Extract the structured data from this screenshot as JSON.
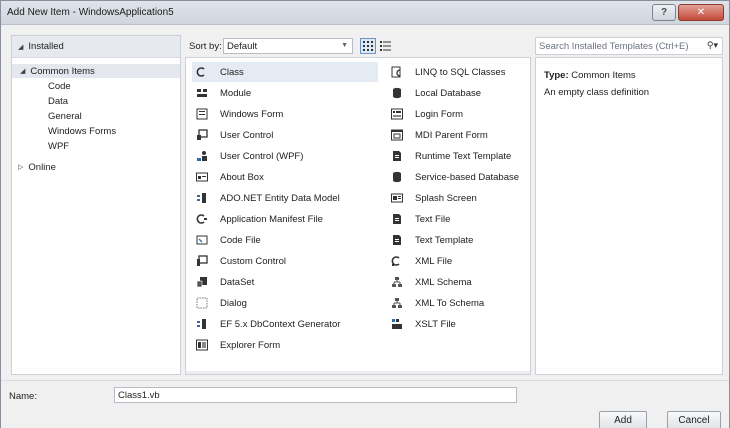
{
  "window": {
    "title": "Add New Item - WindowsApplication5",
    "help_label": "?",
    "close_label": "✕"
  },
  "tree": {
    "installed": "Installed",
    "common_items": "Common Items",
    "children": [
      "Code",
      "Data",
      "General",
      "Windows Forms",
      "WPF"
    ],
    "online": "Online"
  },
  "toolbar": {
    "sort_by_label": "Sort by:",
    "sort_value": "Default"
  },
  "templates": {
    "left": [
      {
        "label": "Class",
        "icon": "class-icon"
      },
      {
        "label": "Module",
        "icon": "module-icon"
      },
      {
        "label": "Windows Form",
        "icon": "form-icon"
      },
      {
        "label": "User Control",
        "icon": "user-control-icon"
      },
      {
        "label": "User Control (WPF)",
        "icon": "wpf-control-icon"
      },
      {
        "label": "About Box",
        "icon": "about-box-icon"
      },
      {
        "label": "ADO.NET Entity Data Model",
        "icon": "entity-model-icon"
      },
      {
        "label": "Application Manifest File",
        "icon": "manifest-icon"
      },
      {
        "label": "Code File",
        "icon": "code-file-icon"
      },
      {
        "label": "Custom Control",
        "icon": "custom-control-icon"
      },
      {
        "label": "DataSet",
        "icon": "dataset-icon"
      },
      {
        "label": "Dialog",
        "icon": "dialog-icon"
      },
      {
        "label": "EF 5.x DbContext Generator",
        "icon": "dbcontext-icon"
      },
      {
        "label": "Explorer Form",
        "icon": "explorer-form-icon"
      }
    ],
    "right": [
      {
        "label": "LINQ to SQL Classes",
        "icon": "linq-icon"
      },
      {
        "label": "Local Database",
        "icon": "database-icon"
      },
      {
        "label": "Login Form",
        "icon": "login-form-icon"
      },
      {
        "label": "MDI Parent Form",
        "icon": "mdi-form-icon"
      },
      {
        "label": "Runtime Text Template",
        "icon": "text-template-icon"
      },
      {
        "label": "Service-based Database",
        "icon": "service-database-icon"
      },
      {
        "label": "Splash Screen",
        "icon": "splash-screen-icon"
      },
      {
        "label": "Text File",
        "icon": "text-file-icon"
      },
      {
        "label": "Text Template",
        "icon": "text-template-icon"
      },
      {
        "label": "XML File",
        "icon": "xml-file-icon"
      },
      {
        "label": "XML Schema",
        "icon": "xml-schema-icon"
      },
      {
        "label": "XML To Schema",
        "icon": "xml-to-schema-icon"
      },
      {
        "label": "XSLT File",
        "icon": "xslt-file-icon"
      }
    ]
  },
  "search": {
    "placeholder": "Search Installed Templates (Ctrl+E)"
  },
  "details": {
    "type_label": "Type:",
    "type_value": "Common Items",
    "description": "An empty class definition"
  },
  "bottom": {
    "name_label": "Name:",
    "name_value": "Class1.vb",
    "add_label": "Add",
    "cancel_label": "Cancel"
  }
}
